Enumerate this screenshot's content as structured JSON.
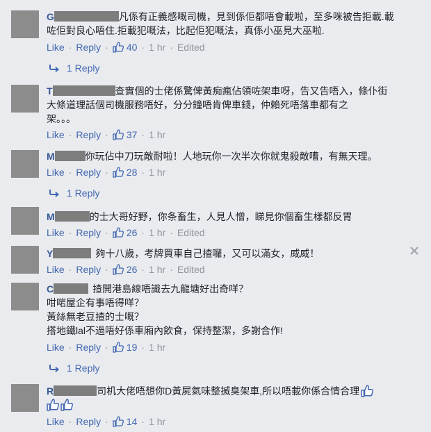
{
  "comments": [
    {
      "author": "G",
      "lines": [
        "凡係有正義感嘅司機，見到係佢都唔會載啦，至多咪被告拒載.載",
        "咗佢對良心唔住.拒載犯嘅法，比起佢犯嘅法，真係小巫見大巫啦."
      ],
      "likes": "40",
      "time": "1 hr",
      "edited": "Edited"
    },
    {
      "author": "T",
      "lines": [
        "查實個的士佬係驚俾黃痴瘋佔領咗架車呀，告又告唔入，條仆街",
        "大條道理話個司機服務唔好，分分鐘唔肯俾車錢，仲賴死唔落車都有之",
        "架。。。"
      ],
      "likes": "37",
      "time": "1 hr"
    },
    {
      "author": "M",
      "lines": [
        "你玩佔中刀玩敵耐啦！人地玩你一次半次你就鬼殺敵嘈，有無天理。"
      ],
      "likes": "28",
      "time": "1 hr"
    },
    {
      "author": "M",
      "lines": [
        "的士大哥好野，你条畜生，人見人憎，睇見你個畜生樣都反胃"
      ],
      "likes": "26",
      "time": "1 hr",
      "edited": "Edited"
    },
    {
      "author": "Y",
      "lines": [
        "夠十八歲，考牌買車自己揸囉，又可以滿女，威威！"
      ],
      "likes": "26",
      "time": "1 hr",
      "edited": "Edited"
    },
    {
      "author": "C",
      "lines": [
        "揸開港島線唔識去九龍塘好出奇咩？",
        "咁啱屋企有事唔得咩？",
        "黃絲無老豆揸的士嘅？",
        "搭地鐵lal不過唔好係車廂內飲食，保持整潔，多謝合作!"
      ],
      "likes": "19",
      "time": "1 hr"
    },
    {
      "author": "R",
      "lines": [
        "司机大佬唔想你D黃屍氣味整揻臭架車,所以唔載你係合情合理"
      ],
      "likes": "14",
      "time": "1 hr"
    }
  ],
  "ui": {
    "like_label": "Like",
    "reply_label": "Reply",
    "one_reply": "1 Reply",
    "dot": "·"
  },
  "colors": {
    "link": "#4267b2",
    "author": "#365899",
    "meta": "#90949c",
    "background": "#e9ebee"
  }
}
